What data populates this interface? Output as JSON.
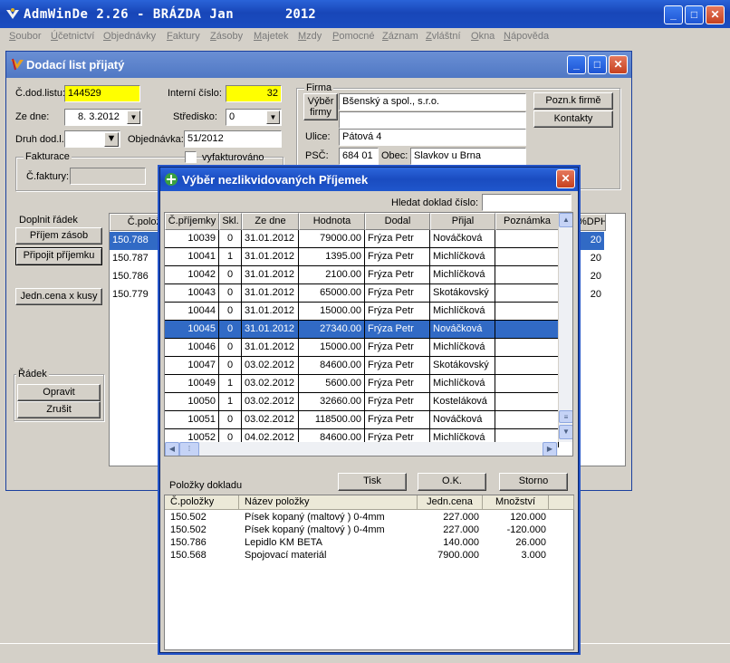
{
  "app": {
    "title": "AdmWinDe 2.26 - BRÁZDA Jan",
    "year": "2012",
    "menu": [
      "Soubor",
      "Účetnictví",
      "Objednávky",
      "Faktury",
      "Zásoby",
      "Majetek",
      "Mzdy",
      "Pomocné",
      "Záznam",
      "Zvláštní",
      "Okna",
      "Nápověda"
    ]
  },
  "doc": {
    "title": "Dodací list přijatý",
    "c_dod_listu_label": "Č.dod.listu:",
    "c_dod_listu": "144529",
    "interni_cislo_label": "Interní číslo:",
    "interni_cislo": "32",
    "ze_dne_label": "Ze dne:",
    "ze_dne": "8. 3.2012",
    "stredisko_label": "Středisko:",
    "stredisko": "0",
    "druh_label": "Druh dod.l.:",
    "druh": "",
    "objednavka_label": "Objednávka:",
    "objednavka": "51/2012",
    "fakturace_label": "Fakturace",
    "vyfakturovano_label": "vyfakturováno",
    "c_faktury_label": "Č.faktury:",
    "c_faktury": "",
    "firma_label": "Firma",
    "vyber_firmy_line1": "Výběr",
    "vyber_firmy_line2": "firmy",
    "firma_name": "Bšenský a spol., s.r.o.",
    "firma_name2": "",
    "ulice_label": "Ulice:",
    "ulice": "Pátová 4",
    "psc_label": "PSČ:",
    "psc": "684 01",
    "obec_label": "Obec:",
    "obec": "Slavkov u Brna",
    "pozn_firme": "Pozn.k firmě",
    "kontakty": "Kontakty",
    "doplnit_radek": "Doplnit řádek",
    "prijem_zasob": "Příjem zásob",
    "pripojit_prijemku": "Připojit příjemku",
    "jedn_cena": "Jedn.cena x kusy",
    "radek_label": "Řádek",
    "opravit": "Opravit",
    "zrusit": "Zrušit",
    "table_headers": [
      "Č.polož",
      "%DPH"
    ],
    "rows": [
      {
        "code": "150.788",
        "dph": "20"
      },
      {
        "code": "150.787",
        "dph": "20"
      },
      {
        "code": "150.786",
        "dph": "20"
      },
      {
        "code": "150.779",
        "dph": "20"
      }
    ]
  },
  "dialog": {
    "title": "Výběr nezlikvidovaných Příjemek",
    "search_label": "Hledat doklad číslo:",
    "search_value": "",
    "headers": [
      "Č.příjemky",
      "Skl.",
      "Ze dne",
      "Hodnota",
      "Dodal",
      "Přijal",
      "Poznámka"
    ],
    "rows": [
      [
        "10039",
        "0",
        "31.01.2012",
        "79000.00",
        "Frýza Petr",
        "Nováčková",
        ""
      ],
      [
        "10041",
        "1",
        "31.01.2012",
        "1395.00",
        "Frýza Petr",
        "Michlíčková",
        ""
      ],
      [
        "10042",
        "0",
        "31.01.2012",
        "2100.00",
        "Frýza Petr",
        "Michlíčková",
        ""
      ],
      [
        "10043",
        "0",
        "31.01.2012",
        "65000.00",
        "Frýza Petr",
        "Skotákovský",
        ""
      ],
      [
        "10044",
        "0",
        "31.01.2012",
        "15000.00",
        "Frýza Petr",
        "Michlíčková",
        ""
      ],
      [
        "10045",
        "0",
        "31.01.2012",
        "27340.00",
        "Frýza Petr",
        "Nováčková",
        ""
      ],
      [
        "10046",
        "0",
        "31.01.2012",
        "15000.00",
        "Frýza Petr",
        "Michlíčková",
        ""
      ],
      [
        "10047",
        "0",
        "03.02.2012",
        "84600.00",
        "Frýza Petr",
        "Skotákovský",
        ""
      ],
      [
        "10049",
        "1",
        "03.02.2012",
        "5600.00",
        "Frýza Petr",
        "Michlíčková",
        ""
      ],
      [
        "10050",
        "1",
        "03.02.2012",
        "32660.00",
        "Frýza Petr",
        "Kosteláková",
        ""
      ],
      [
        "10051",
        "0",
        "03.02.2012",
        "118500.00",
        "Frýza Petr",
        "Nováčková",
        ""
      ],
      [
        "10052",
        "0",
        "04.02.2012",
        "84600.00",
        "Frýza Petr",
        "Michlíčková",
        ""
      ]
    ],
    "selected_row": 5,
    "polozky_label": "Položky dokladu",
    "tisk": "Tisk",
    "ok": "O.K.",
    "storno": "Storno",
    "items_headers": [
      "Č.položky",
      "Název položky",
      "Jedn.cena",
      "Množství"
    ],
    "items": [
      [
        "150.502",
        "Písek kopaný (maltový ) 0-4mm",
        "227.000",
        "120.000"
      ],
      [
        "150.502",
        "Písek kopaný (maltový ) 0-4mm",
        "227.000",
        "-120.000"
      ],
      [
        "150.786",
        "Lepidlo KM BETA",
        "140.000",
        "26.000"
      ],
      [
        "150.568",
        "Spojovací materiál",
        "7900.000",
        "3.000"
      ]
    ]
  }
}
